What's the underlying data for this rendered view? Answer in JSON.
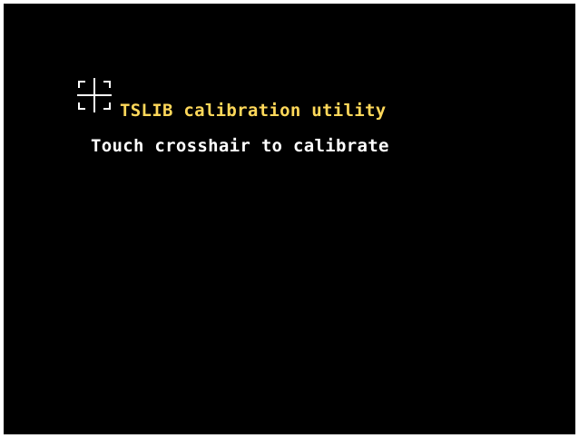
{
  "screen": {
    "background_color": "#000000",
    "crosshair": {
      "icon": "crosshair-icon",
      "color": "#ffffff"
    },
    "title": {
      "text": "TSLIB calibration utility",
      "color": "#ffd85a"
    },
    "instruction": {
      "text": "Touch crosshair to calibrate",
      "color": "#ffffff"
    }
  }
}
